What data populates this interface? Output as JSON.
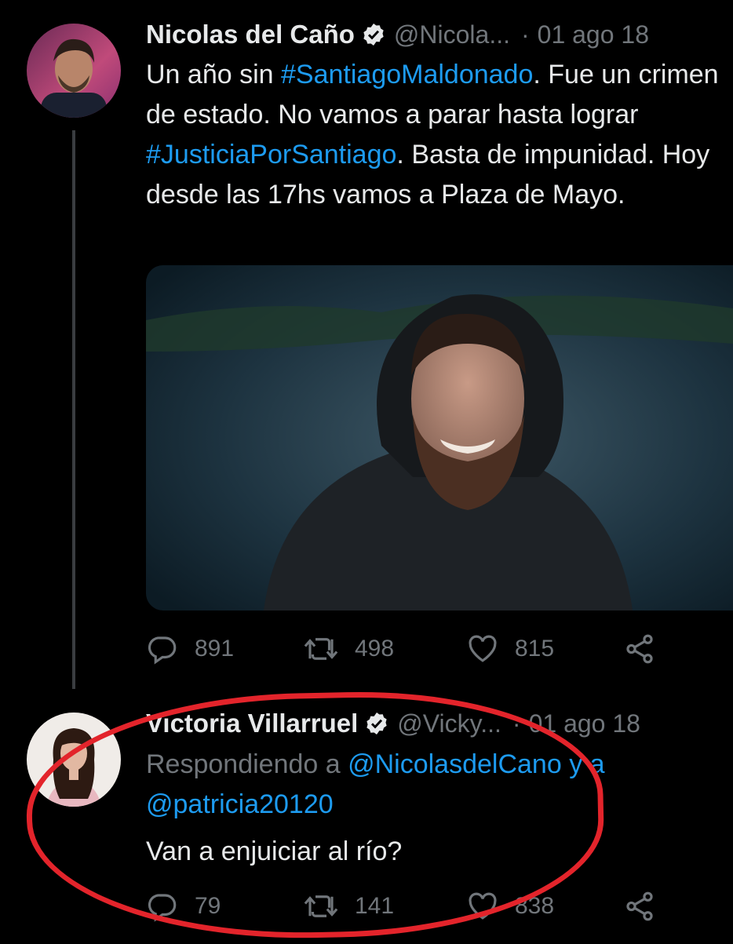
{
  "tweets": [
    {
      "name": "Nicolas del Caño",
      "handle": "@Nicola...",
      "separator": "·",
      "date": "01 ago 18",
      "text_parts": {
        "p1": "Un año sin ",
        "tag1": "#SantiagoMaldonado",
        "p2": ". Fue un crimen de estado. No vamos a parar hasta lograr ",
        "tag2": "#JusticiaPorSantiago",
        "p3": ". Basta de impunidad. Hoy desde las 17hs vamos a Plaza de Mayo."
      },
      "stats": {
        "replies": "891",
        "retweets": "498",
        "likes": "815"
      }
    },
    {
      "name": "Victoria Villarruel",
      "handle": "@Vicky...",
      "separator": "·",
      "date": "01 ago 18",
      "reply_prefix": "Respondiendo a ",
      "reply_user1": "@NicolasdelCano",
      "reply_joiner": " y a ",
      "reply_user2": "@patricia20120",
      "text": "Van a enjuiciar al río?",
      "stats": {
        "replies": "79",
        "retweets": "141",
        "likes": "838"
      }
    }
  ],
  "icons": [
    "verified-badge-icon",
    "reply-icon",
    "retweet-icon",
    "like-icon",
    "share-icon"
  ],
  "colors": {
    "background": "#000000",
    "link": "#1d9bf0",
    "muted": "#71767b",
    "annotation": "#e3242b"
  }
}
